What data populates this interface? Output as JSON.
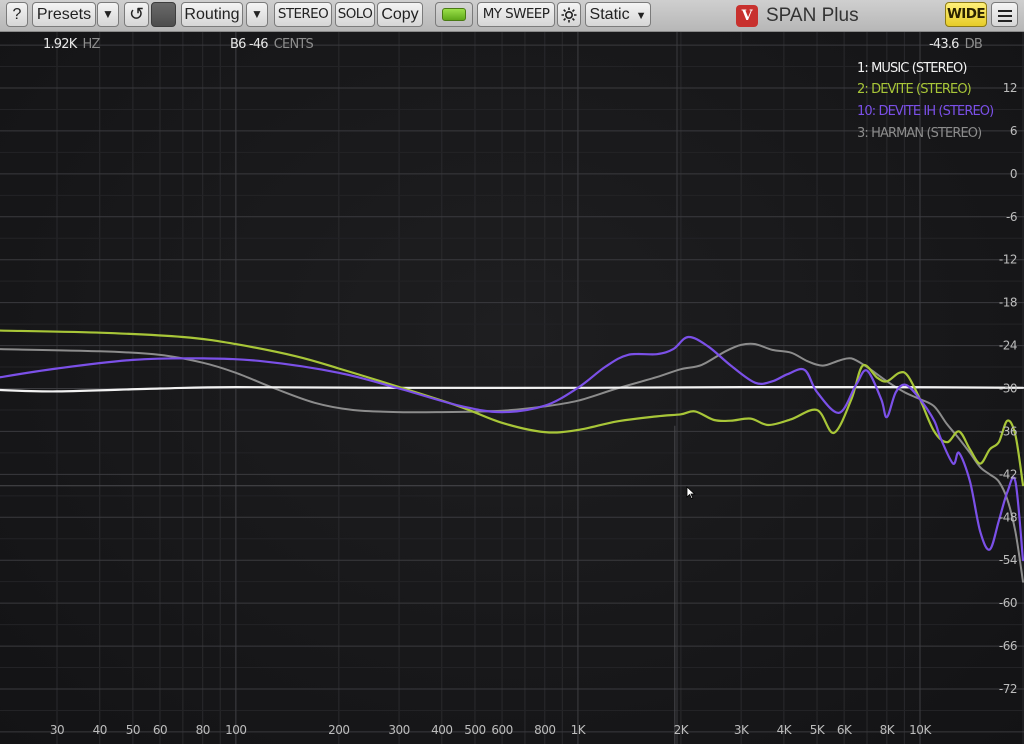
{
  "toolbar": {
    "help_label": "?",
    "presets_label": "Presets",
    "presets_dropdown_label": "▼",
    "reset_icon": "↺",
    "routing_label": "Routing",
    "routing_dropdown_label": "▼",
    "stereo_label": "STEREO",
    "solo_label": "SOLO",
    "copy_label": "Copy",
    "mysweep_label": "MY SWEEP",
    "static_label": "Static",
    "static_arrow": "▼",
    "brand_mark": "V",
    "app_title": "SPAN Plus",
    "wide_label": "WIDE"
  },
  "readout": {
    "frequency": "1.92K",
    "frequency_unit": "HZ",
    "note": "B6 -46",
    "note_unit": "CENTS",
    "level": "-43.6",
    "level_unit": "DB"
  },
  "legend": [
    {
      "label": "1: MUSIC (STEREO)",
      "color": "#f2f2f2"
    },
    {
      "label": "2: DEVITE (STEREO)",
      "color": "#a8c638"
    },
    {
      "label": "10: DEVITE IH (STEREO)",
      "color": "#7b50e8"
    },
    {
      "label": "3: HARMAN (STEREO)",
      "color": "#8c8c8c"
    }
  ],
  "chart_data": {
    "type": "line",
    "x_scale": "log",
    "xlim": [
      20,
      20000
    ],
    "ylim": [
      -78,
      18
    ],
    "x_ticks": [
      {
        "value": 30,
        "label": "30"
      },
      {
        "value": 40,
        "label": "40"
      },
      {
        "value": 50,
        "label": "50"
      },
      {
        "value": 60,
        "label": "60"
      },
      {
        "value": 80,
        "label": "80"
      },
      {
        "value": 100,
        "label": "100"
      },
      {
        "value": 200,
        "label": "200"
      },
      {
        "value": 300,
        "label": "300"
      },
      {
        "value": 400,
        "label": "400"
      },
      {
        "value": 500,
        "label": "500"
      },
      {
        "value": 600,
        "label": "600"
      },
      {
        "value": 800,
        "label": "800"
      },
      {
        "value": 1000,
        "label": "1K"
      },
      {
        "value": 2000,
        "label": "2K"
      },
      {
        "value": 3000,
        "label": "3K"
      },
      {
        "value": 4000,
        "label": "4K"
      },
      {
        "value": 5000,
        "label": "5K"
      },
      {
        "value": 6000,
        "label": "6K"
      },
      {
        "value": 8000,
        "label": "8K"
      },
      {
        "value": 10000,
        "label": "10K"
      }
    ],
    "y_ticks": [
      12,
      6,
      0,
      -6,
      -12,
      -18,
      -24,
      -30,
      -36,
      -42,
      -48,
      -54,
      -60,
      -66,
      -72
    ],
    "cursor": {
      "freq": 1920,
      "db": -43.6
    },
    "series": [
      {
        "name": "1: MUSIC (STEREO)",
        "color": "#f2f2f2",
        "width": 2.2,
        "points": [
          [
            20,
            -30.2
          ],
          [
            30,
            -30.4
          ],
          [
            60,
            -30
          ],
          [
            100,
            -29.8
          ],
          [
            300,
            -29.9
          ],
          [
            1000,
            -29.9
          ],
          [
            3000,
            -29.8
          ],
          [
            8000,
            -29.8
          ],
          [
            20000,
            -29.9
          ]
        ]
      },
      {
        "name": "2: DEVITE (STEREO)",
        "color": "#a8c638",
        "width": 2.2,
        "points": [
          [
            20,
            -21.9
          ],
          [
            40,
            -22.2
          ],
          [
            70,
            -22.8
          ],
          [
            100,
            -23.8
          ],
          [
            150,
            -25.5
          ],
          [
            200,
            -27.2
          ],
          [
            300,
            -29.8
          ],
          [
            450,
            -32.5
          ],
          [
            600,
            -34.8
          ],
          [
            800,
            -36.1
          ],
          [
            1000,
            -35.8
          ],
          [
            1300,
            -34.6
          ],
          [
            1700,
            -33.9
          ],
          [
            2000,
            -33.6
          ],
          [
            2200,
            -33.2
          ],
          [
            2500,
            -34.4
          ],
          [
            2800,
            -34.5
          ],
          [
            3200,
            -34.2
          ],
          [
            3600,
            -35.1
          ],
          [
            4200,
            -34.3
          ],
          [
            5000,
            -33
          ],
          [
            5600,
            -36.2
          ],
          [
            6300,
            -31.5
          ],
          [
            6800,
            -26.8
          ],
          [
            7500,
            -28.5
          ],
          [
            8000,
            -29
          ],
          [
            8700,
            -27.8
          ],
          [
            9200,
            -28.2
          ],
          [
            10000,
            -31.5
          ],
          [
            11000,
            -36
          ],
          [
            12000,
            -37.5
          ],
          [
            13000,
            -36
          ],
          [
            14000,
            -38.5
          ],
          [
            15000,
            -40.5
          ],
          [
            16000,
            -38.5
          ],
          [
            17000,
            -37.5
          ],
          [
            18000,
            -34.5
          ],
          [
            19000,
            -36.5
          ],
          [
            20000,
            -43.5
          ]
        ]
      },
      {
        "name": "10: DEVITE IH (STEREO)",
        "color": "#7b50e8",
        "width": 2.2,
        "points": [
          [
            20,
            -28.5
          ],
          [
            30,
            -27.2
          ],
          [
            50,
            -26
          ],
          [
            80,
            -25.8
          ],
          [
            120,
            -26.2
          ],
          [
            200,
            -27.8
          ],
          [
            300,
            -30
          ],
          [
            450,
            -32.4
          ],
          [
            600,
            -33.3
          ],
          [
            800,
            -32.4
          ],
          [
            1000,
            -29.9
          ],
          [
            1200,
            -27
          ],
          [
            1400,
            -25.3
          ],
          [
            1700,
            -25.2
          ],
          [
            1900,
            -24.5
          ],
          [
            2100,
            -22.8
          ],
          [
            2400,
            -24.1
          ],
          [
            2800,
            -26.8
          ],
          [
            3300,
            -29.2
          ],
          [
            3700,
            -29
          ],
          [
            4100,
            -28
          ],
          [
            4600,
            -27.4
          ],
          [
            5000,
            -30.5
          ],
          [
            5800,
            -33.4
          ],
          [
            6500,
            -29.5
          ],
          [
            7000,
            -27.5
          ],
          [
            7700,
            -31.5
          ],
          [
            8000,
            -34
          ],
          [
            8500,
            -30.5
          ],
          [
            9100,
            -29.5
          ],
          [
            10000,
            -31.5
          ],
          [
            11000,
            -34.5
          ],
          [
            11500,
            -37
          ],
          [
            12500,
            -40.5
          ],
          [
            13000,
            -39
          ],
          [
            14000,
            -43
          ],
          [
            15000,
            -50
          ],
          [
            16000,
            -52.5
          ],
          [
            17000,
            -48.5
          ],
          [
            18000,
            -44.5
          ],
          [
            19000,
            -43
          ],
          [
            20000,
            -54
          ]
        ]
      },
      {
        "name": "3: HARMAN (STEREO)",
        "color": "#8c8c8c",
        "width": 2.0,
        "points": [
          [
            20,
            -24.5
          ],
          [
            40,
            -24.8
          ],
          [
            60,
            -25.3
          ],
          [
            80,
            -26.4
          ],
          [
            100,
            -27.8
          ],
          [
            130,
            -30
          ],
          [
            170,
            -32
          ],
          [
            220,
            -33
          ],
          [
            300,
            -33.3
          ],
          [
            400,
            -33.3
          ],
          [
            600,
            -33.1
          ],
          [
            800,
            -32.5
          ],
          [
            1000,
            -31.7
          ],
          [
            1300,
            -30
          ],
          [
            1700,
            -28.4
          ],
          [
            2000,
            -27.3
          ],
          [
            2300,
            -26.7
          ],
          [
            2700,
            -24.8
          ],
          [
            3000,
            -23.9
          ],
          [
            3300,
            -23.8
          ],
          [
            3700,
            -24.6
          ],
          [
            4200,
            -25
          ],
          [
            4700,
            -26.2
          ],
          [
            5200,
            -26.8
          ],
          [
            5800,
            -26.1
          ],
          [
            6300,
            -25.8
          ],
          [
            7000,
            -27
          ],
          [
            8000,
            -29
          ],
          [
            9000,
            -30.5
          ],
          [
            10000,
            -31.5
          ],
          [
            11000,
            -32.5
          ],
          [
            12000,
            -35
          ],
          [
            13000,
            -37
          ],
          [
            14000,
            -39
          ],
          [
            15000,
            -41
          ],
          [
            16000,
            -42
          ],
          [
            17000,
            -43
          ],
          [
            18000,
            -45.5
          ],
          [
            19000,
            -50
          ],
          [
            20000,
            -57
          ]
        ]
      }
    ]
  }
}
